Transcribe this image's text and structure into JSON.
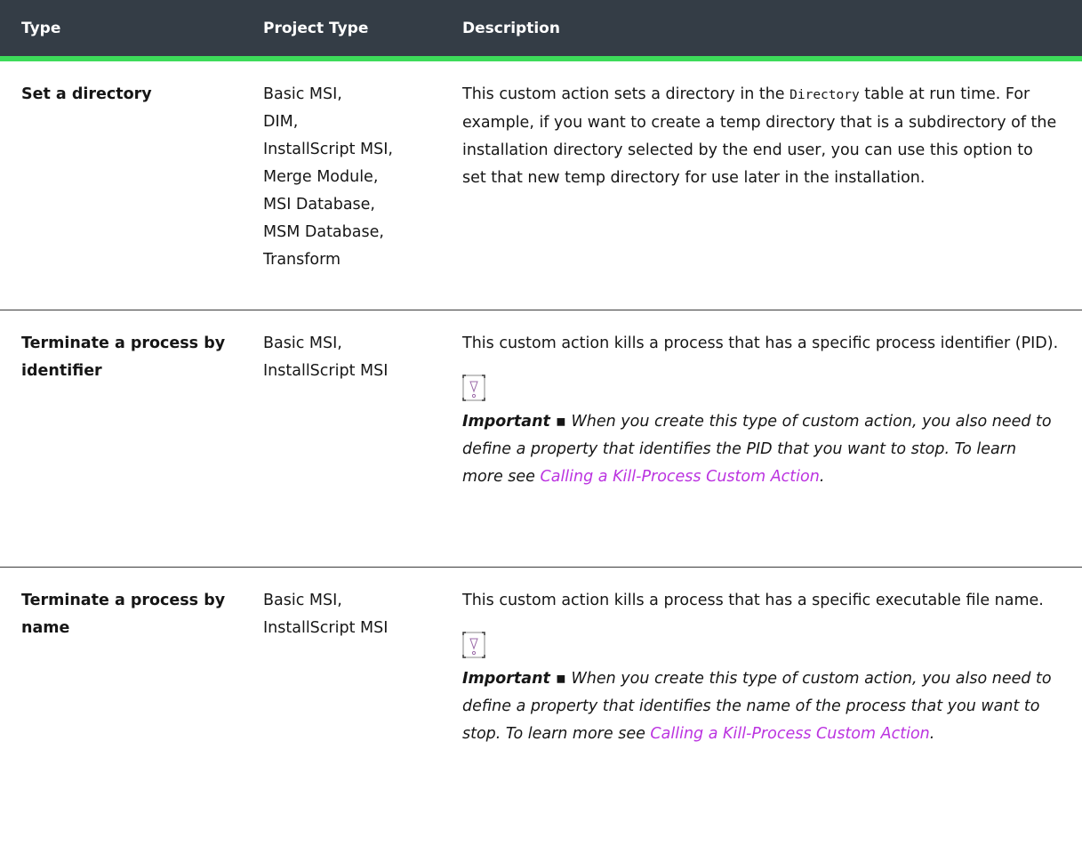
{
  "header": {
    "type": "Type",
    "project_type": "Project Type",
    "description": "Description"
  },
  "rows": [
    {
      "type": "Set a directory",
      "projects": [
        "Basic MSI,",
        "DIM,",
        "InstallScript MSI,",
        "Merge Module,",
        "MSI Database,",
        "MSM Database,",
        "Transform"
      ],
      "desc_before": "This custom action sets a directory in the ",
      "desc_code": "Directory",
      "desc_after": " table at run time. For example, if you want to create a temp directory that is a subdirectory of the installation directory selected by the end user, you can use this option to set that new temp directory for use later in the installation."
    },
    {
      "type": "Terminate a process by identifier",
      "projects": [
        "Basic MSI,",
        "InstallScript MSI"
      ],
      "desc": "This custom action kills a process that has a specific process identifier (PID).",
      "icon": "warning-icon",
      "important_label": "Important ▪",
      "important_text": " When you create this type of custom action, you also need to define a property that identifies the PID that you want to stop. To learn more see ",
      "link": "Calling a Kill-Process Custom Action",
      "after_link": "."
    },
    {
      "type": "Terminate a process by name",
      "projects": [
        "Basic MSI,",
        "InstallScript MSI"
      ],
      "desc": "This custom action kills a process that has a specific executable file name.",
      "icon": "warning-icon",
      "important_label": "Important ▪",
      "important_text": " When you create this type of custom action, you also need to define a property that identifies the name of the process that you want to stop. To learn more see ",
      "link": "Calling a Kill-Process Custom Action",
      "after_link": "."
    }
  ],
  "colors": {
    "header_bg": "#343d46",
    "header_accent": "#3ddb5a",
    "link": "#bb33e0"
  }
}
